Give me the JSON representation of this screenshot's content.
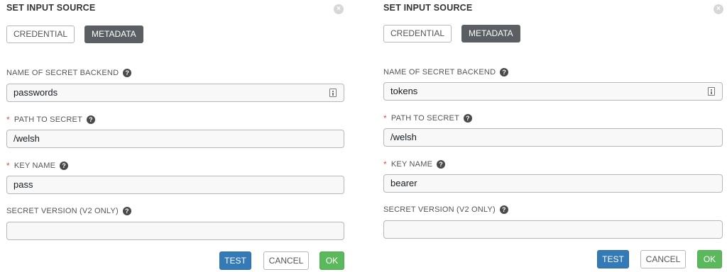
{
  "panels": [
    {
      "title": "SET INPUT SOURCE",
      "close_icon": "close-icon",
      "tabs": [
        "CREDENTIAL",
        "METADATA"
      ],
      "active_tab": "METADATA",
      "fields": {
        "backend": {
          "label": "NAME OF SECRET BACKEND",
          "value": "passwords",
          "required": false
        },
        "path": {
          "label": "PATH TO SECRET",
          "value": "/welsh",
          "required": true
        },
        "key": {
          "label": "KEY NAME",
          "value": "pass",
          "required": true
        },
        "version": {
          "label": "SECRET VERSION (V2 ONLY)",
          "value": "",
          "required": false
        }
      },
      "buttons": {
        "test": "TEST",
        "cancel": "CANCEL",
        "ok": "OK"
      }
    },
    {
      "title": "SET INPUT SOURCE",
      "close_icon": "close-icon",
      "tabs": [
        "CREDENTIAL",
        "METADATA"
      ],
      "active_tab": "METADATA",
      "fields": {
        "backend": {
          "label": "NAME OF SECRET BACKEND",
          "value": "tokens",
          "required": false
        },
        "path": {
          "label": "PATH TO SECRET",
          "value": "/welsh",
          "required": true
        },
        "key": {
          "label": "KEY NAME",
          "value": "bearer",
          "required": true
        },
        "version": {
          "label": "SECRET VERSION (V2 ONLY)",
          "value": "",
          "required": false
        }
      },
      "buttons": {
        "test": "TEST",
        "cancel": "CANCEL",
        "ok": "OK"
      }
    }
  ],
  "required_marker": "*",
  "help_glyph": "?",
  "close_glyph": "×",
  "colors": {
    "active_tab": "#5b5f63",
    "test_button": "#337ab7",
    "ok_button": "#5cb85c",
    "required_marker": "#d9534f"
  }
}
